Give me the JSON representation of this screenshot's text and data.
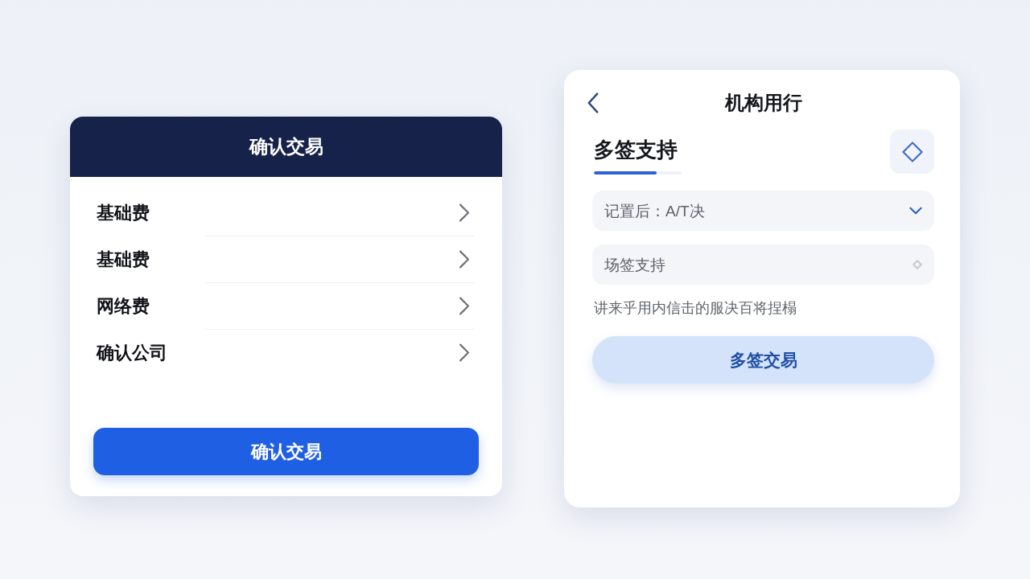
{
  "left_panel": {
    "title": "确认交易",
    "items": [
      {
        "label": "基础费"
      },
      {
        "label": "基础费"
      },
      {
        "label": "网络费"
      },
      {
        "label": "确认公司"
      }
    ],
    "confirm_button": "确认交易"
  },
  "right_panel": {
    "title": "机构用行",
    "section": {
      "tab": "多签支持",
      "progress": {
        "level": 0.72
      }
    },
    "fields": [
      {
        "kind": "select",
        "value": "记置后：A/T决"
      },
      {
        "kind": "input",
        "value": "场签支持"
      }
    ],
    "hint": "讲来乎用内信击的服决百将捏榻",
    "button": "多签交易"
  }
}
